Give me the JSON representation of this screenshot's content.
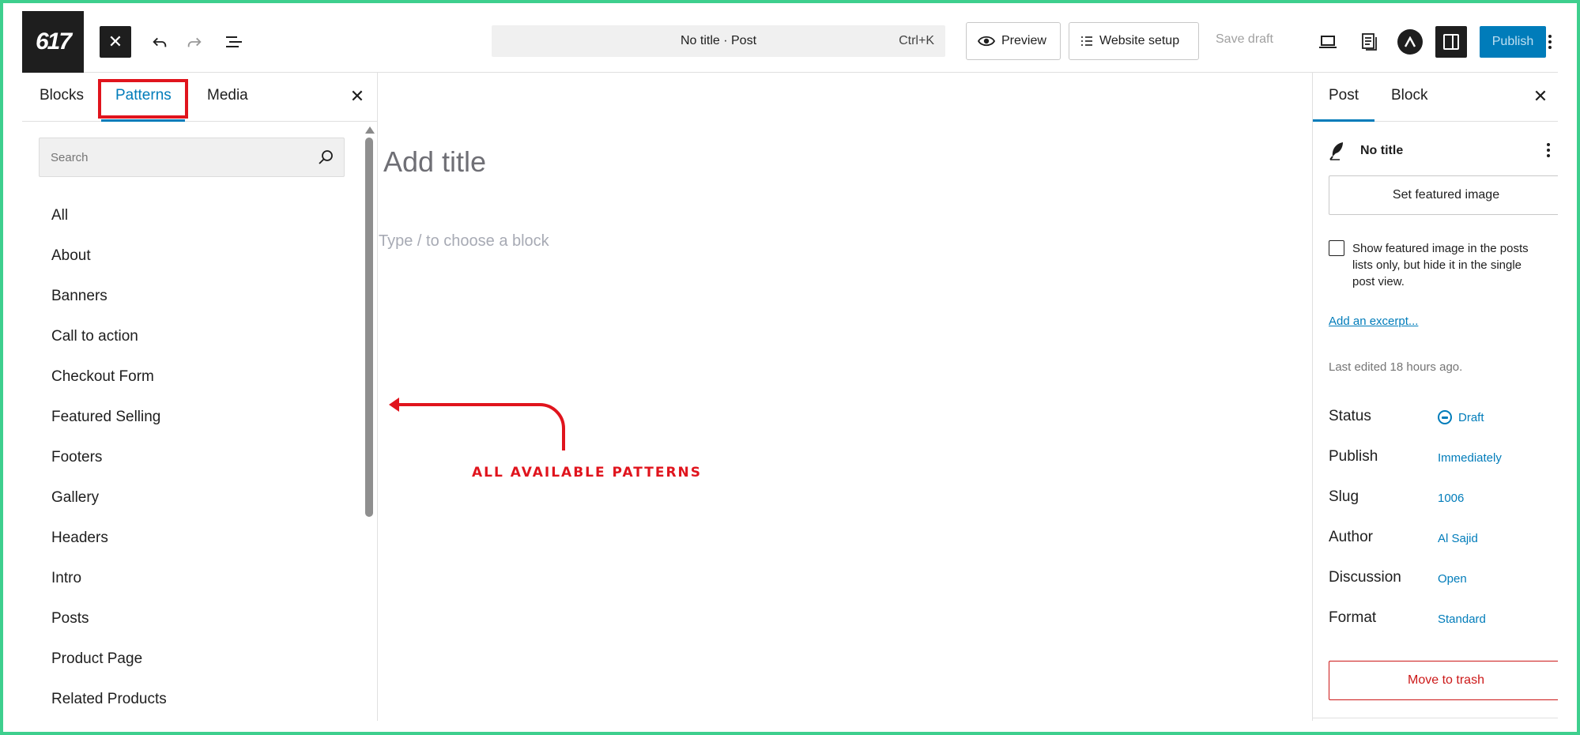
{
  "header": {
    "logo_text": "617",
    "document_title": "No title · Post",
    "shortcut": "Ctrl+K",
    "preview_label": "Preview",
    "website_setup_label": "Website setup",
    "save_draft_label": "Save draft",
    "publish_label": "Publish",
    "close_icon": "close-icon",
    "undo_icon": "undo-icon",
    "redo_icon": "redo-icon",
    "list_view_icon": "list-view-icon",
    "accent_color": "#007cba"
  },
  "inserter": {
    "tabs": [
      {
        "label": "Blocks"
      },
      {
        "label": "Patterns"
      },
      {
        "label": "Media"
      }
    ],
    "active_tab": "Patterns",
    "search_placeholder": "Search",
    "categories": [
      "All",
      "About",
      "Banners",
      "Call to action",
      "Checkout Form",
      "Featured Selling",
      "Footers",
      "Gallery",
      "Headers",
      "Intro",
      "Posts",
      "Product Page",
      "Related Products"
    ]
  },
  "canvas": {
    "title_placeholder": "Add title",
    "block_placeholder": "Type / to choose a block",
    "annotation": "ALL AVAILABLE PATTERNS",
    "annotation_color": "#e0141d"
  },
  "sidebar": {
    "tabs": [
      {
        "label": "Post"
      },
      {
        "label": "Block"
      }
    ],
    "active_tab": "Post",
    "post_title": "No title",
    "featured_image_button": "Set featured image",
    "featured_checkbox_label": "Show featured image in the posts lists only, but hide it in the single post view.",
    "featured_checkbox_checked": false,
    "excerpt_link": "Add an excerpt...",
    "last_edited": "Last edited 18 hours ago.",
    "meta": [
      {
        "key": "Status",
        "value": "Draft"
      },
      {
        "key": "Publish",
        "value": "Immediately"
      },
      {
        "key": "Slug",
        "value": "1006"
      },
      {
        "key": "Author",
        "value": "Al Sajid"
      },
      {
        "key": "Discussion",
        "value": "Open"
      },
      {
        "key": "Format",
        "value": "Standard"
      }
    ],
    "trash_button": "Move to trash",
    "danger_color": "#cc1818"
  }
}
